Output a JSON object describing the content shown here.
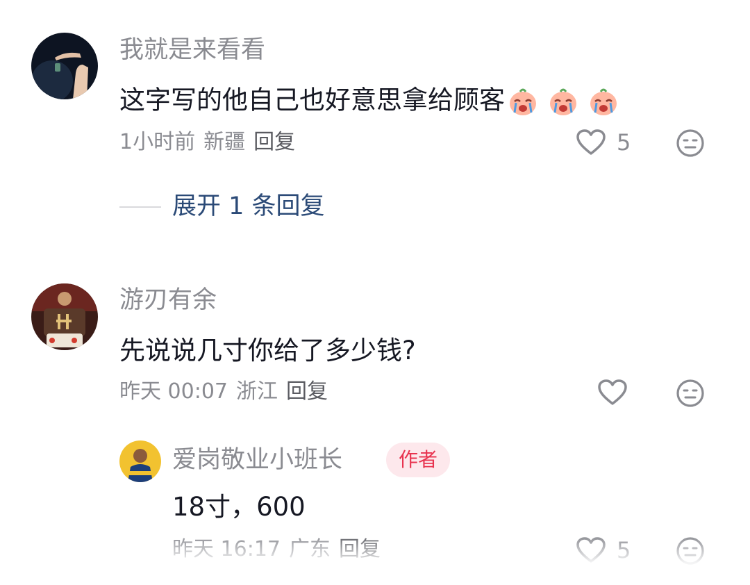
{
  "comments": [
    {
      "username": "我就是来看看",
      "text": "这字写的他自己也好意思拿给顾客",
      "emojis": [
        "crying-peach-emoji",
        "crying-peach-emoji",
        "crying-peach-emoji"
      ],
      "time": "1小时前",
      "location": "新疆",
      "reply_label": "回复",
      "likes": "5",
      "expand_label": "展开 1 条回复"
    },
    {
      "username": "游刃有余",
      "text": "先说说几寸你给了多少钱?",
      "time": "昨天 00:07",
      "location": "浙江",
      "reply_label": "回复",
      "likes": ""
    }
  ],
  "reply": {
    "username": "爱岗敬业小班长",
    "badge": "作者",
    "text": "18寸，600",
    "time": "昨天 16:17",
    "location": "广东",
    "reply_label": "回复",
    "likes": "5"
  },
  "colors": {
    "username": "#8a8b91",
    "content": "#161823",
    "expand_link": "#2b4a77",
    "author_badge_bg": "#fde8ec",
    "author_badge_text": "#e8334f"
  },
  "icons": {
    "like": "heart-outline-icon",
    "dislike": "neutral-face-icon"
  }
}
